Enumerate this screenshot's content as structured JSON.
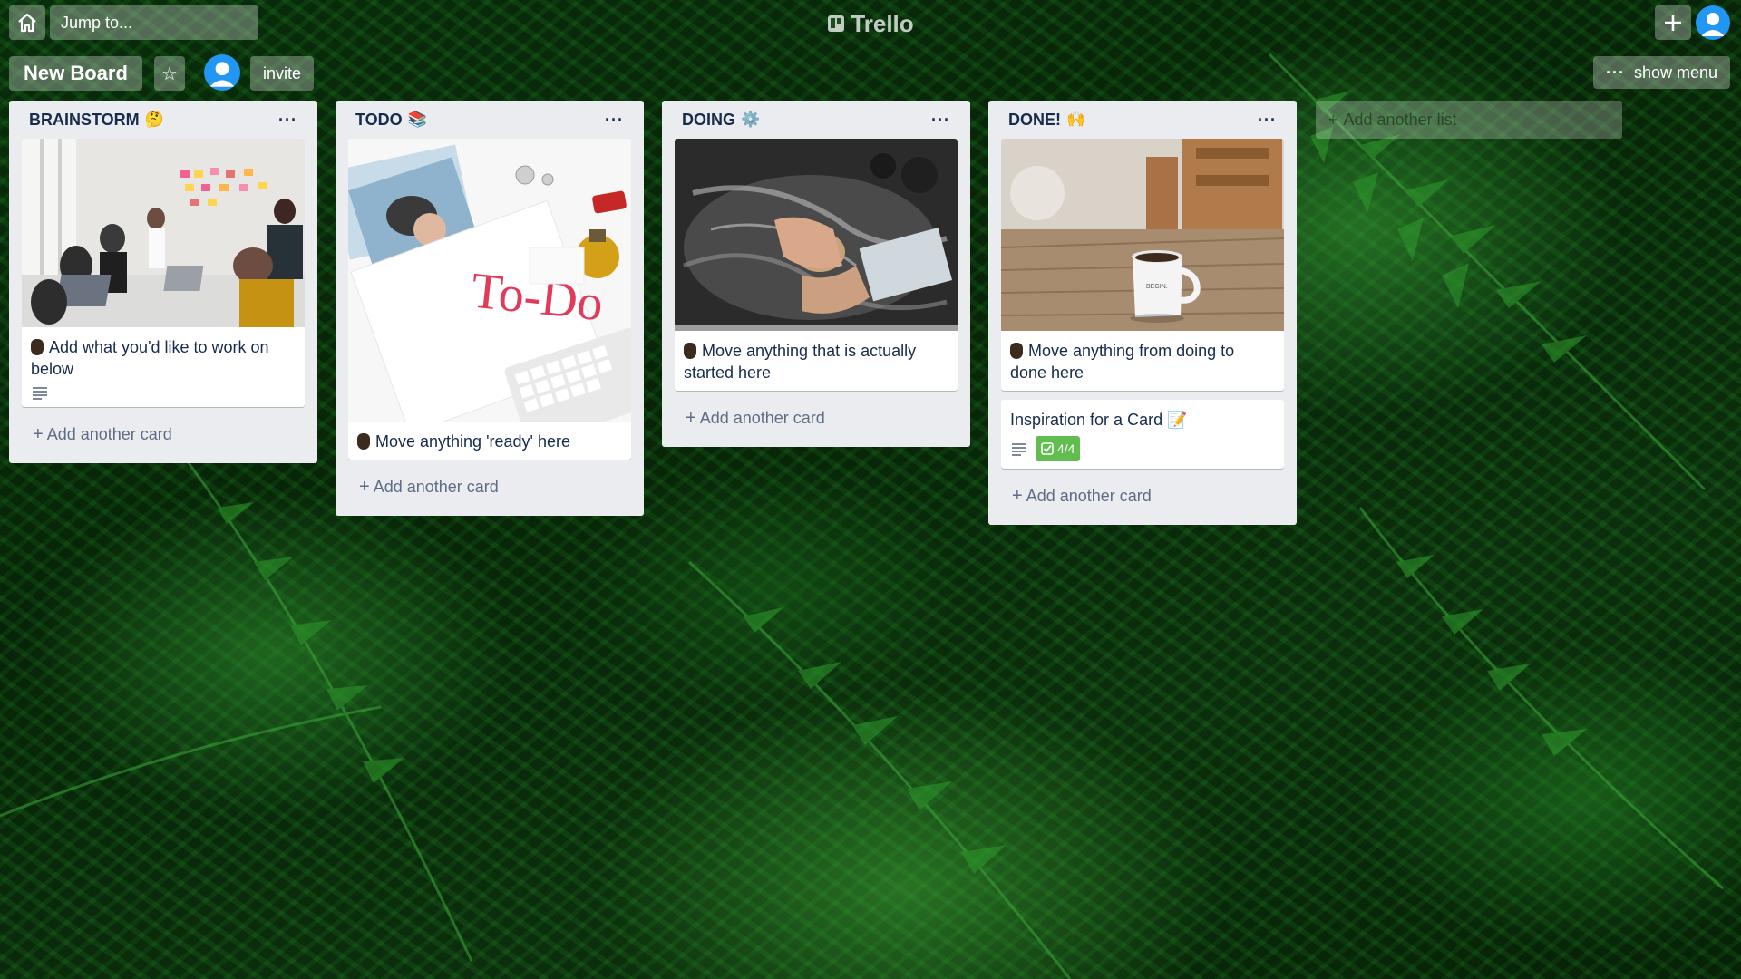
{
  "topbar": {
    "search_placeholder": "Jump to...",
    "logo_text": "Trello"
  },
  "board": {
    "title": "New Board",
    "invite_label": "invite",
    "menu_label": "show menu"
  },
  "lists": [
    {
      "title": "BRAINSTORM",
      "emoji": "🤔",
      "cards": [
        {
          "text": "Add what you'd like to work on below",
          "cover": "meeting-photo"
        }
      ],
      "add_card_label": "Add another card"
    },
    {
      "title": "TODO",
      "emoji": "📚",
      "cards": [
        {
          "text": "Move anything 'ready' here",
          "cover": "todo-desk-photo"
        }
      ],
      "add_card_label": "Add another card"
    },
    {
      "title": "DOING",
      "emoji": "⚙️",
      "cards": [
        {
          "text": "Move anything that is actually started here",
          "cover": "dough-photo"
        }
      ],
      "add_card_label": "Add another card"
    },
    {
      "title": "DONE!",
      "emoji": "🙌",
      "cards": [
        {
          "text": "Move anything from doing to done here",
          "cover": "coffee-mug-photo"
        },
        {
          "text": "Inspiration for a Card",
          "emoji": "📝",
          "checklist": "4/4"
        }
      ],
      "add_card_label": "Add another card"
    }
  ],
  "add_list_label": "Add another list",
  "colors": {
    "list_bg": "#ebecf0",
    "checklist_complete": "#61bd4f",
    "avatar": "#2196f3"
  }
}
